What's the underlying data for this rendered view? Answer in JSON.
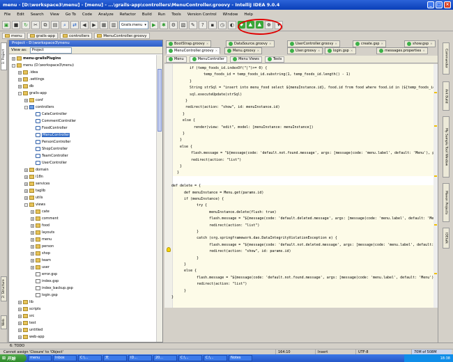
{
  "window": {
    "title": "menu - [D:\\workspace3\\menu] - [menu] - ...\\grails-app\\controllers\\MenuController.groovy - IntelliJ IDEA 9.0.4"
  },
  "menubar": [
    "File",
    "Edit",
    "Search",
    "View",
    "Go To",
    "Code",
    "Analyze",
    "Refactor",
    "Build",
    "Run",
    "Tools",
    "Version Control",
    "Window",
    "Help"
  ],
  "toolbar": {
    "run_config": "Grails:menu"
  },
  "breadcrumb": [
    "menu",
    "grails-app",
    "controllers",
    "MenuController.groovy"
  ],
  "left_stripe": [
    "1: Project",
    "2: Structure",
    "Web"
  ],
  "right_stripe": [
    "Commander",
    "Ant Build",
    "My Sample Tool Window",
    "Maven Projects",
    "IDEtalk"
  ],
  "project_panel": {
    "header": "Project - D:\\workspace3\\menu",
    "view_as_label": "View as:",
    "view_as_value": "Project"
  },
  "tree": [
    {
      "label": "menu-grailsPlugins",
      "depth": 0,
      "icon": "f",
      "toggle": "+",
      "bold": true
    },
    {
      "label": "menu (D:\\workspace3\\menu)",
      "depth": 0,
      "icon": "f",
      "toggle": "-"
    },
    {
      "label": ".idea",
      "depth": 1,
      "icon": "f",
      "toggle": "+"
    },
    {
      "label": ".settings",
      "depth": 1,
      "icon": "f",
      "toggle": "+"
    },
    {
      "label": "db",
      "depth": 1,
      "icon": "f",
      "toggle": "+"
    },
    {
      "label": "grails-app",
      "depth": 1,
      "icon": "f",
      "toggle": "-"
    },
    {
      "label": "conf",
      "depth": 2,
      "icon": "f",
      "toggle": "+"
    },
    {
      "label": "controllers",
      "depth": 2,
      "icon": "s",
      "toggle": "-"
    },
    {
      "label": "CateController",
      "depth": 3,
      "icon": "c"
    },
    {
      "label": "CommentController",
      "depth": 3,
      "icon": "c"
    },
    {
      "label": "FoodController",
      "depth": 3,
      "icon": "c"
    },
    {
      "label": "MenuController",
      "depth": 3,
      "icon": "c",
      "selected": true
    },
    {
      "label": "PersonController",
      "depth": 3,
      "icon": "c"
    },
    {
      "label": "ShopController",
      "depth": 3,
      "icon": "c"
    },
    {
      "label": "TeamController",
      "depth": 3,
      "icon": "c"
    },
    {
      "label": "UserController",
      "depth": 3,
      "icon": "c"
    },
    {
      "label": "domain",
      "depth": 2,
      "icon": "f",
      "toggle": "+"
    },
    {
      "label": "i18n",
      "depth": 2,
      "icon": "f",
      "toggle": "+"
    },
    {
      "label": "services",
      "depth": 2,
      "icon": "f",
      "toggle": "+"
    },
    {
      "label": "taglib",
      "depth": 2,
      "icon": "f",
      "toggle": "+"
    },
    {
      "label": "utils",
      "depth": 2,
      "icon": "f",
      "toggle": "+"
    },
    {
      "label": "views",
      "depth": 2,
      "icon": "f",
      "toggle": "-"
    },
    {
      "label": "cate",
      "depth": 3,
      "icon": "f",
      "toggle": "+"
    },
    {
      "label": "comment",
      "depth": 3,
      "icon": "f",
      "toggle": "+"
    },
    {
      "label": "food",
      "depth": 3,
      "icon": "f",
      "toggle": "+"
    },
    {
      "label": "layouts",
      "depth": 3,
      "icon": "f",
      "toggle": "+"
    },
    {
      "label": "menu",
      "depth": 3,
      "icon": "f",
      "toggle": "+"
    },
    {
      "label": "person",
      "depth": 3,
      "icon": "f",
      "toggle": "+"
    },
    {
      "label": "shop",
      "depth": 3,
      "icon": "f",
      "toggle": "+"
    },
    {
      "label": "team",
      "depth": 3,
      "icon": "f",
      "toggle": "+"
    },
    {
      "label": "user",
      "depth": 3,
      "icon": "f",
      "toggle": "+"
    },
    {
      "label": "error.gsp",
      "depth": 3,
      "icon": "g"
    },
    {
      "label": "index.gsp",
      "depth": 3,
      "icon": "g"
    },
    {
      "label": "index_backup.gsp",
      "depth": 3,
      "icon": "g"
    },
    {
      "label": "login.gsp",
      "depth": 3,
      "icon": "g"
    },
    {
      "label": "lib",
      "depth": 1,
      "icon": "f",
      "toggle": "+"
    },
    {
      "label": "scripts",
      "depth": 1,
      "icon": "f",
      "toggle": "+"
    },
    {
      "label": "src",
      "depth": 1,
      "icon": "f",
      "toggle": "+"
    },
    {
      "label": "test",
      "depth": 1,
      "icon": "f",
      "toggle": "+"
    },
    {
      "label": "untitled",
      "depth": 1,
      "icon": "f",
      "toggle": "+"
    },
    {
      "label": "web-app",
      "depth": 1,
      "icon": "f",
      "toggle": "+"
    }
  ],
  "editor_tabs_row1": [
    "BootStrap.groovy",
    "DataSource.groovy",
    "UserController.groovy",
    "create.gsp",
    "show.gsp"
  ],
  "editor_tabs_row2": [
    "MenuController.groovy",
    "Menu.groovy",
    "User.groovy",
    "login.gsp",
    "messages.properties"
  ],
  "structure_tabs": [
    "Menu",
    "MenuController",
    "Menu Views",
    "Tests"
  ],
  "code": [
    "if (temp_foods_id.indexOf(\"|\")>= 0) {",
    "    temp_foods_id = temp_foods_id.substring(1, temp_foods_id.length() - 1)",
    "}",
    "String strSql = \"insert into menu_food select ${menuInstance.id}, food.id from food where food.id in (${temp_foods_id})\"",
    "sql.executeUpdate(strSql)",
    "}",
    "redirect(action: \"show\", id: menuInstance.id)",
    "}",
    "else {",
    "    render(view: \"edit\", model: [menuInstance: menuInstance])",
    "}",
    "}",
    "else {",
    "    flash.message = \"${message(code: 'default.not.found.message', args: [message(code: 'menu.label', default: 'Menu'), params.id])}\"",
    "    redirect(action: \"list\")",
    "}",
    "}",
    "",
    "def delete = {",
    "    def menuInstance = Menu.get(params.id)",
    "    if (menuInstance) {",
    "        try {",
    "            menuInstance.delete(flush: true)",
    "            flash.message = \"${message(code: 'default.deleted.message', args: [message(code: 'menu.label', default: 'Menu'), params.id])}\"",
    "            redirect(action: \"list\")",
    "        }",
    "        catch (org.springframework.dao.DataIntegrityViolationException e) {",
    "            flash.message = \"${message(code: 'default.not.deleted.message', args: [message(code: 'menu.label', default: 'Menu'), params.id])}\"",
    "            redirect(action: \"show\", id: params.id)",
    "        }",
    "    }",
    "    else {",
    "        flash.message = \"${message(code: 'default.not.found.message', args: [message(code: 'menu.label', default: 'Menu'), params.id])}\"",
    "        redirect(action: \"list\")",
    "    }",
    "}"
  ],
  "bottom_tabs": [
    "6: TODO"
  ],
  "status": {
    "message": "Cannot assign 'Closure' to 'Object'",
    "position": "164:10",
    "mode": "Insert",
    "encoding": "UTF-8",
    "memory": "70M of 508M"
  },
  "taskbar": {
    "start": "开始",
    "clock": "18:38",
    "tasks": [
      "menu",
      "Inbox",
      "C:\\...",
      "天",
      "ID...",
      "20...",
      "C:\\...",
      "C:\\...",
      "Notes"
    ]
  }
}
